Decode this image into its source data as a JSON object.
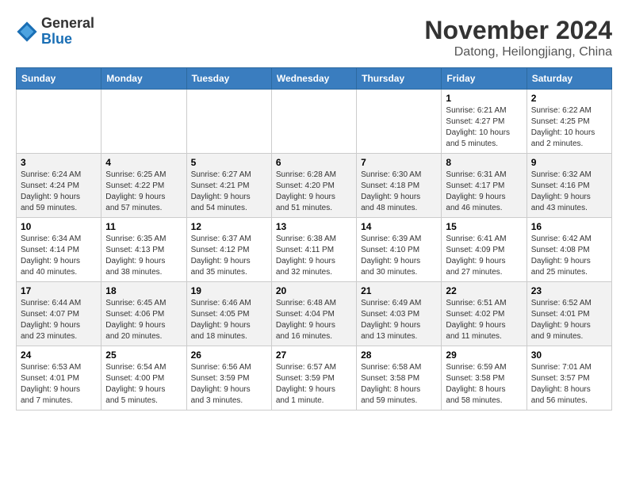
{
  "logo": {
    "general": "General",
    "blue": "Blue"
  },
  "title": {
    "month": "November 2024",
    "location": "Datong, Heilongjiang, China"
  },
  "weekdays": [
    "Sunday",
    "Monday",
    "Tuesday",
    "Wednesday",
    "Thursday",
    "Friday",
    "Saturday"
  ],
  "weeks": [
    [
      {
        "day": "",
        "info": ""
      },
      {
        "day": "",
        "info": ""
      },
      {
        "day": "",
        "info": ""
      },
      {
        "day": "",
        "info": ""
      },
      {
        "day": "",
        "info": ""
      },
      {
        "day": "1",
        "info": "Sunrise: 6:21 AM\nSunset: 4:27 PM\nDaylight: 10 hours\nand 5 minutes."
      },
      {
        "day": "2",
        "info": "Sunrise: 6:22 AM\nSunset: 4:25 PM\nDaylight: 10 hours\nand 2 minutes."
      }
    ],
    [
      {
        "day": "3",
        "info": "Sunrise: 6:24 AM\nSunset: 4:24 PM\nDaylight: 9 hours\nand 59 minutes."
      },
      {
        "day": "4",
        "info": "Sunrise: 6:25 AM\nSunset: 4:22 PM\nDaylight: 9 hours\nand 57 minutes."
      },
      {
        "day": "5",
        "info": "Sunrise: 6:27 AM\nSunset: 4:21 PM\nDaylight: 9 hours\nand 54 minutes."
      },
      {
        "day": "6",
        "info": "Sunrise: 6:28 AM\nSunset: 4:20 PM\nDaylight: 9 hours\nand 51 minutes."
      },
      {
        "day": "7",
        "info": "Sunrise: 6:30 AM\nSunset: 4:18 PM\nDaylight: 9 hours\nand 48 minutes."
      },
      {
        "day": "8",
        "info": "Sunrise: 6:31 AM\nSunset: 4:17 PM\nDaylight: 9 hours\nand 46 minutes."
      },
      {
        "day": "9",
        "info": "Sunrise: 6:32 AM\nSunset: 4:16 PM\nDaylight: 9 hours\nand 43 minutes."
      }
    ],
    [
      {
        "day": "10",
        "info": "Sunrise: 6:34 AM\nSunset: 4:14 PM\nDaylight: 9 hours\nand 40 minutes."
      },
      {
        "day": "11",
        "info": "Sunrise: 6:35 AM\nSunset: 4:13 PM\nDaylight: 9 hours\nand 38 minutes."
      },
      {
        "day": "12",
        "info": "Sunrise: 6:37 AM\nSunset: 4:12 PM\nDaylight: 9 hours\nand 35 minutes."
      },
      {
        "day": "13",
        "info": "Sunrise: 6:38 AM\nSunset: 4:11 PM\nDaylight: 9 hours\nand 32 minutes."
      },
      {
        "day": "14",
        "info": "Sunrise: 6:39 AM\nSunset: 4:10 PM\nDaylight: 9 hours\nand 30 minutes."
      },
      {
        "day": "15",
        "info": "Sunrise: 6:41 AM\nSunset: 4:09 PM\nDaylight: 9 hours\nand 27 minutes."
      },
      {
        "day": "16",
        "info": "Sunrise: 6:42 AM\nSunset: 4:08 PM\nDaylight: 9 hours\nand 25 minutes."
      }
    ],
    [
      {
        "day": "17",
        "info": "Sunrise: 6:44 AM\nSunset: 4:07 PM\nDaylight: 9 hours\nand 23 minutes."
      },
      {
        "day": "18",
        "info": "Sunrise: 6:45 AM\nSunset: 4:06 PM\nDaylight: 9 hours\nand 20 minutes."
      },
      {
        "day": "19",
        "info": "Sunrise: 6:46 AM\nSunset: 4:05 PM\nDaylight: 9 hours\nand 18 minutes."
      },
      {
        "day": "20",
        "info": "Sunrise: 6:48 AM\nSunset: 4:04 PM\nDaylight: 9 hours\nand 16 minutes."
      },
      {
        "day": "21",
        "info": "Sunrise: 6:49 AM\nSunset: 4:03 PM\nDaylight: 9 hours\nand 13 minutes."
      },
      {
        "day": "22",
        "info": "Sunrise: 6:51 AM\nSunset: 4:02 PM\nDaylight: 9 hours\nand 11 minutes."
      },
      {
        "day": "23",
        "info": "Sunrise: 6:52 AM\nSunset: 4:01 PM\nDaylight: 9 hours\nand 9 minutes."
      }
    ],
    [
      {
        "day": "24",
        "info": "Sunrise: 6:53 AM\nSunset: 4:01 PM\nDaylight: 9 hours\nand 7 minutes."
      },
      {
        "day": "25",
        "info": "Sunrise: 6:54 AM\nSunset: 4:00 PM\nDaylight: 9 hours\nand 5 minutes."
      },
      {
        "day": "26",
        "info": "Sunrise: 6:56 AM\nSunset: 3:59 PM\nDaylight: 9 hours\nand 3 minutes."
      },
      {
        "day": "27",
        "info": "Sunrise: 6:57 AM\nSunset: 3:59 PM\nDaylight: 9 hours\nand 1 minute."
      },
      {
        "day": "28",
        "info": "Sunrise: 6:58 AM\nSunset: 3:58 PM\nDaylight: 8 hours\nand 59 minutes."
      },
      {
        "day": "29",
        "info": "Sunrise: 6:59 AM\nSunset: 3:58 PM\nDaylight: 8 hours\nand 58 minutes."
      },
      {
        "day": "30",
        "info": "Sunrise: 7:01 AM\nSunset: 3:57 PM\nDaylight: 8 hours\nand 56 minutes."
      }
    ]
  ]
}
